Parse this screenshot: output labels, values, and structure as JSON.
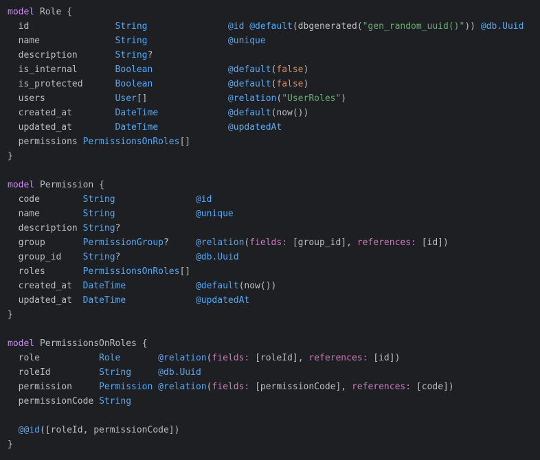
{
  "editor": {
    "colors": {
      "background": "#1e1f22",
      "text": "#bcbec4",
      "keyword": "#cf8dfb",
      "type": "#56a8f5",
      "attribute": "#56a8f5",
      "string": "#6aab73",
      "boolean": "#cf8e6d",
      "named_argument": "#c77dbb"
    },
    "lines": [
      {
        "tokens": [
          {
            "t": "kw",
            "v": "model"
          },
          {
            "t": "name",
            "v": " Role "
          },
          {
            "t": "br",
            "v": "{"
          }
        ]
      },
      {
        "tokens": [
          {
            "t": "fld",
            "v": "  id                "
          },
          {
            "t": "type",
            "v": "String"
          },
          {
            "t": "txt",
            "v": "               "
          },
          {
            "t": "attr",
            "v": "@id"
          },
          {
            "t": "txt",
            "v": " "
          },
          {
            "t": "attr",
            "v": "@default"
          },
          {
            "t": "punc",
            "v": "(dbgenerated("
          },
          {
            "t": "str",
            "v": "\"gen_random_uuid()\""
          },
          {
            "t": "punc",
            "v": ")) "
          },
          {
            "t": "attr",
            "v": "@db.Uuid"
          }
        ]
      },
      {
        "tokens": [
          {
            "t": "fld",
            "v": "  name              "
          },
          {
            "t": "type",
            "v": "String"
          },
          {
            "t": "txt",
            "v": "               "
          },
          {
            "t": "attr",
            "v": "@unique"
          }
        ]
      },
      {
        "tokens": [
          {
            "t": "fld",
            "v": "  description       "
          },
          {
            "t": "type",
            "v": "String"
          },
          {
            "t": "punc",
            "v": "?"
          }
        ]
      },
      {
        "tokens": [
          {
            "t": "fld",
            "v": "  is_internal       "
          },
          {
            "t": "type",
            "v": "Boolean"
          },
          {
            "t": "txt",
            "v": "              "
          },
          {
            "t": "attr",
            "v": "@default"
          },
          {
            "t": "punc",
            "v": "("
          },
          {
            "t": "bool",
            "v": "false"
          },
          {
            "t": "punc",
            "v": ")"
          }
        ]
      },
      {
        "tokens": [
          {
            "t": "fld",
            "v": "  is_protected      "
          },
          {
            "t": "type",
            "v": "Boolean"
          },
          {
            "t": "txt",
            "v": "              "
          },
          {
            "t": "attr",
            "v": "@default"
          },
          {
            "t": "punc",
            "v": "("
          },
          {
            "t": "bool",
            "v": "false"
          },
          {
            "t": "punc",
            "v": ")"
          }
        ]
      },
      {
        "tokens": [
          {
            "t": "fld",
            "v": "  users             "
          },
          {
            "t": "type",
            "v": "User"
          },
          {
            "t": "punc",
            "v": "[]"
          },
          {
            "t": "txt",
            "v": "               "
          },
          {
            "t": "attr",
            "v": "@relation"
          },
          {
            "t": "punc",
            "v": "("
          },
          {
            "t": "str",
            "v": "\"UserRoles\""
          },
          {
            "t": "punc",
            "v": ")"
          }
        ]
      },
      {
        "tokens": [
          {
            "t": "fld",
            "v": "  created_at        "
          },
          {
            "t": "type",
            "v": "DateTime"
          },
          {
            "t": "txt",
            "v": "             "
          },
          {
            "t": "attr",
            "v": "@default"
          },
          {
            "t": "punc",
            "v": "(now())"
          }
        ]
      },
      {
        "tokens": [
          {
            "t": "fld",
            "v": "  updated_at        "
          },
          {
            "t": "type",
            "v": "DateTime"
          },
          {
            "t": "txt",
            "v": "             "
          },
          {
            "t": "attr",
            "v": "@updatedAt"
          }
        ]
      },
      {
        "tokens": [
          {
            "t": "fld",
            "v": "  permissions "
          },
          {
            "t": "type",
            "v": "PermissionsOnRoles"
          },
          {
            "t": "punc",
            "v": "[]"
          }
        ]
      },
      {
        "tokens": [
          {
            "t": "br",
            "v": "}"
          }
        ]
      },
      {
        "tokens": []
      },
      {
        "tokens": [
          {
            "t": "kw",
            "v": "model"
          },
          {
            "t": "name",
            "v": " Permission "
          },
          {
            "t": "br",
            "v": "{"
          }
        ]
      },
      {
        "tokens": [
          {
            "t": "fld",
            "v": "  code        "
          },
          {
            "t": "type",
            "v": "String"
          },
          {
            "t": "txt",
            "v": "               "
          },
          {
            "t": "attr",
            "v": "@id"
          }
        ]
      },
      {
        "tokens": [
          {
            "t": "fld",
            "v": "  name        "
          },
          {
            "t": "type",
            "v": "String"
          },
          {
            "t": "txt",
            "v": "               "
          },
          {
            "t": "attr",
            "v": "@unique"
          }
        ]
      },
      {
        "tokens": [
          {
            "t": "fld",
            "v": "  description "
          },
          {
            "t": "type",
            "v": "String"
          },
          {
            "t": "punc",
            "v": "?"
          }
        ]
      },
      {
        "tokens": [
          {
            "t": "fld",
            "v": "  group       "
          },
          {
            "t": "type",
            "v": "PermissionGroup"
          },
          {
            "t": "punc",
            "v": "?"
          },
          {
            "t": "txt",
            "v": "     "
          },
          {
            "t": "attr",
            "v": "@relation"
          },
          {
            "t": "punc",
            "v": "("
          },
          {
            "t": "arg",
            "v": "fields:"
          },
          {
            "t": "punc",
            "v": " [group_id], "
          },
          {
            "t": "arg",
            "v": "references:"
          },
          {
            "t": "punc",
            "v": " [id])"
          }
        ]
      },
      {
        "tokens": [
          {
            "t": "fld",
            "v": "  group_id    "
          },
          {
            "t": "type",
            "v": "String"
          },
          {
            "t": "punc",
            "v": "?"
          },
          {
            "t": "txt",
            "v": "              "
          },
          {
            "t": "attr",
            "v": "@db.Uuid"
          }
        ]
      },
      {
        "tokens": [
          {
            "t": "fld",
            "v": "  roles       "
          },
          {
            "t": "type",
            "v": "PermissionsOnRoles"
          },
          {
            "t": "punc",
            "v": "[]"
          }
        ]
      },
      {
        "tokens": [
          {
            "t": "fld",
            "v": "  created_at  "
          },
          {
            "t": "type",
            "v": "DateTime"
          },
          {
            "t": "txt",
            "v": "             "
          },
          {
            "t": "attr",
            "v": "@default"
          },
          {
            "t": "punc",
            "v": "(now())"
          }
        ]
      },
      {
        "tokens": [
          {
            "t": "fld",
            "v": "  updated_at  "
          },
          {
            "t": "type",
            "v": "DateTime"
          },
          {
            "t": "txt",
            "v": "             "
          },
          {
            "t": "attr",
            "v": "@updatedAt"
          }
        ]
      },
      {
        "tokens": [
          {
            "t": "br",
            "v": "}"
          }
        ]
      },
      {
        "tokens": []
      },
      {
        "tokens": [
          {
            "t": "kw",
            "v": "model"
          },
          {
            "t": "name",
            "v": " PermissionsOnRoles "
          },
          {
            "t": "br",
            "v": "{"
          }
        ]
      },
      {
        "tokens": [
          {
            "t": "fld",
            "v": "  role           "
          },
          {
            "t": "type",
            "v": "Role"
          },
          {
            "t": "txt",
            "v": "       "
          },
          {
            "t": "attr",
            "v": "@relation"
          },
          {
            "t": "punc",
            "v": "("
          },
          {
            "t": "arg",
            "v": "fields:"
          },
          {
            "t": "punc",
            "v": " [roleId], "
          },
          {
            "t": "arg",
            "v": "references:"
          },
          {
            "t": "punc",
            "v": " [id])"
          }
        ]
      },
      {
        "tokens": [
          {
            "t": "fld",
            "v": "  roleId         "
          },
          {
            "t": "type",
            "v": "String"
          },
          {
            "t": "txt",
            "v": "     "
          },
          {
            "t": "attr",
            "v": "@db.Uuid"
          }
        ]
      },
      {
        "tokens": [
          {
            "t": "fld",
            "v": "  permission     "
          },
          {
            "t": "type",
            "v": "Permission"
          },
          {
            "t": "txt",
            "v": " "
          },
          {
            "t": "attr",
            "v": "@relation"
          },
          {
            "t": "punc",
            "v": "("
          },
          {
            "t": "arg",
            "v": "fields:"
          },
          {
            "t": "punc",
            "v": " [permissionCode], "
          },
          {
            "t": "arg",
            "v": "references:"
          },
          {
            "t": "punc",
            "v": " [code])"
          }
        ]
      },
      {
        "tokens": [
          {
            "t": "fld",
            "v": "  permissionCode "
          },
          {
            "t": "type",
            "v": "String"
          }
        ]
      },
      {
        "tokens": []
      },
      {
        "tokens": [
          {
            "t": "txt",
            "v": "  "
          },
          {
            "t": "attr",
            "v": "@@id"
          },
          {
            "t": "punc",
            "v": "([roleId, permissionCode])"
          }
        ]
      },
      {
        "tokens": [
          {
            "t": "br",
            "v": "}"
          }
        ]
      }
    ]
  }
}
